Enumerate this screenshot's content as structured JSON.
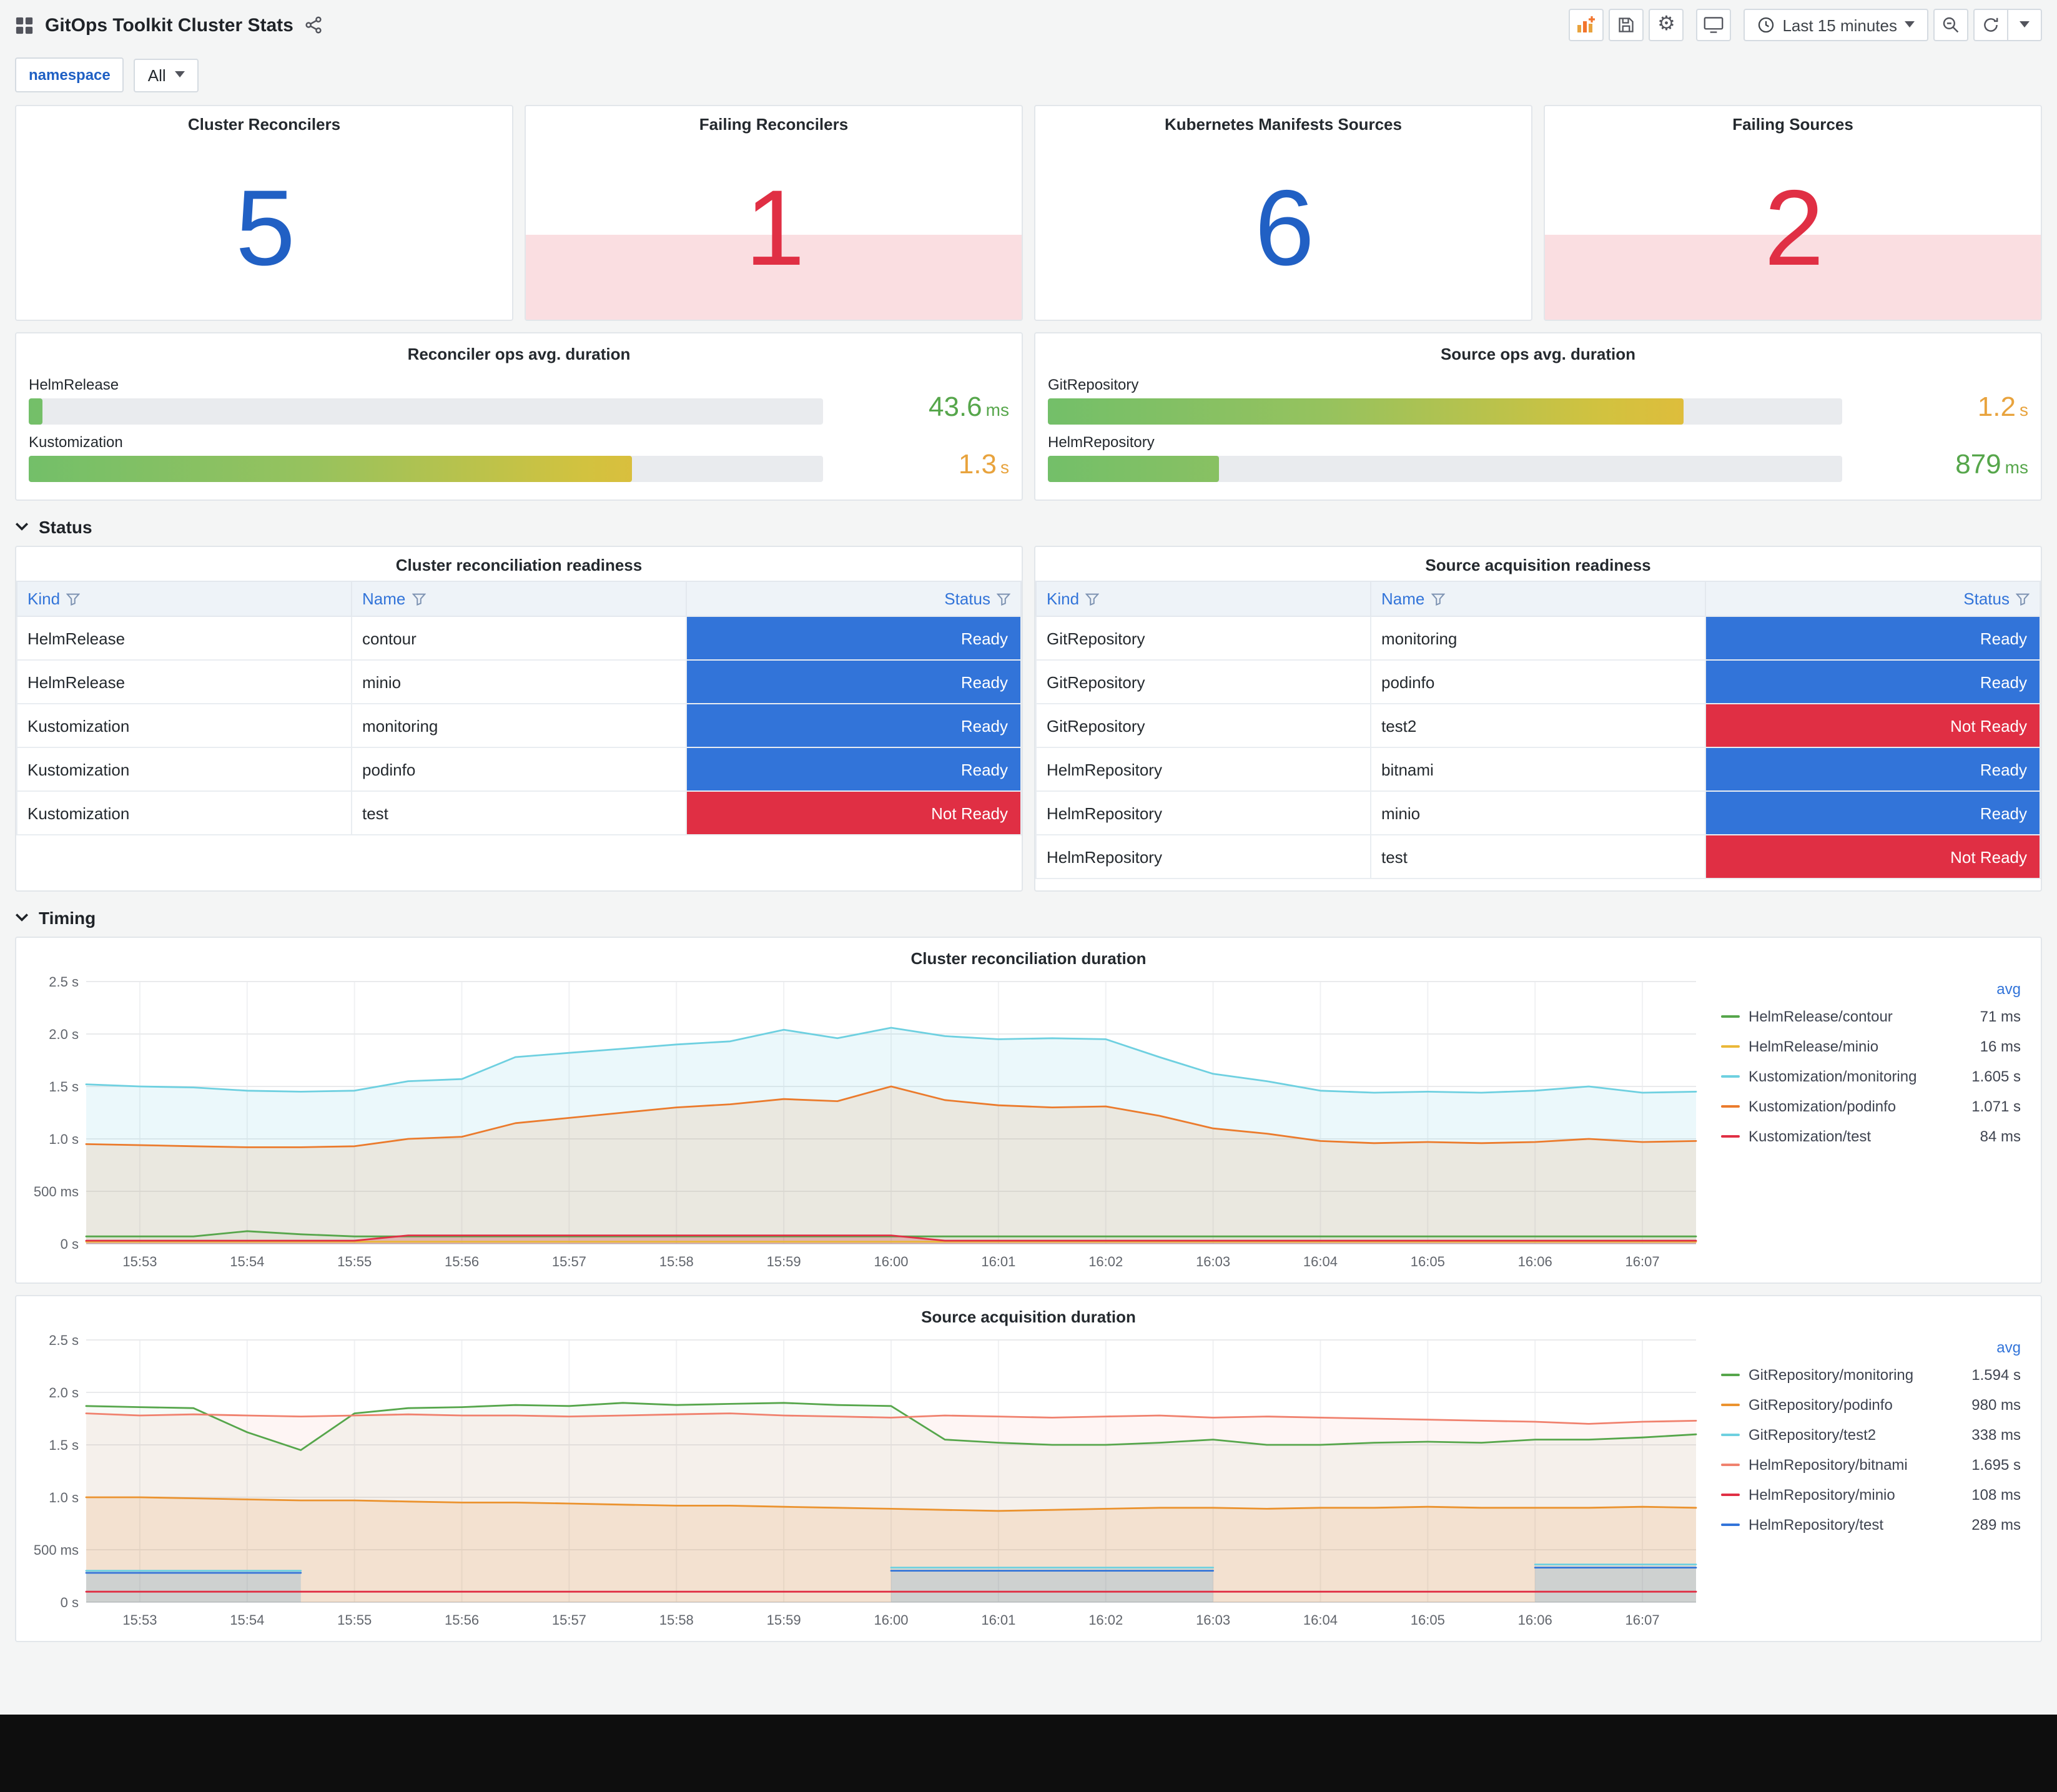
{
  "header": {
    "title": "GitOps Toolkit Cluster Stats",
    "time_range": "Last 15 minutes"
  },
  "icons": {
    "grid-icon": "four-squares",
    "share-icon": "share-nodes",
    "add-panel-icon": "bar-chart-plus",
    "save-icon": "floppy-disk",
    "gear-icon": "⚙",
    "monitor-icon": "tv-display",
    "clock-icon": "clock-face",
    "caret-down-icon": "▾",
    "zoom-out-icon": "magnifier-minus",
    "refresh-icon": "circular-arrows",
    "chevron-down-icon": "⌄",
    "filter-icon": "funnel"
  },
  "variables": {
    "label": "namespace",
    "value": "All"
  },
  "stats": [
    {
      "title": "Cluster Reconcilers",
      "value": "5",
      "color": "#2160c4",
      "alert": false
    },
    {
      "title": "Failing Reconcilers",
      "value": "1",
      "color": "#e02f44",
      "alert": true
    },
    {
      "title": "Kubernetes Manifests Sources",
      "value": "6",
      "color": "#2160c4",
      "alert": false
    },
    {
      "title": "Failing Sources",
      "value": "2",
      "color": "#e02f44",
      "alert": true
    }
  ],
  "gauges": [
    {
      "title": "Reconciler ops avg. duration",
      "rows": [
        {
          "label": "HelmRelease",
          "value": "43.6",
          "unit": "ms",
          "pct": 1.8,
          "value_color": "#56a64b"
        },
        {
          "label": "Kustomization",
          "value": "1.3",
          "unit": "s",
          "pct": 76,
          "value_color": "#e8a33d"
        }
      ]
    },
    {
      "title": "Source ops avg. duration",
      "rows": [
        {
          "label": "GitRepository",
          "value": "1.2",
          "unit": "s",
          "pct": 80,
          "value_color": "#e8a33d"
        },
        {
          "label": "HelmRepository",
          "value": "879",
          "unit": "ms",
          "pct": 21.5,
          "value_color": "#56a64b"
        }
      ]
    }
  ],
  "status": {
    "section_label": "Status",
    "status_colors": {
      "Ready": "#3274d9",
      "Not Ready": "#e02f44"
    },
    "tables": [
      {
        "title": "Cluster reconciliation readiness",
        "columns": [
          "Kind",
          "Name",
          "Status"
        ],
        "rows": [
          [
            "HelmRelease",
            "contour",
            "Ready"
          ],
          [
            "HelmRelease",
            "minio",
            "Ready"
          ],
          [
            "Kustomization",
            "monitoring",
            "Ready"
          ],
          [
            "Kustomization",
            "podinfo",
            "Ready"
          ],
          [
            "Kustomization",
            "test",
            "Not Ready"
          ]
        ]
      },
      {
        "title": "Source acquisition readiness",
        "columns": [
          "Kind",
          "Name",
          "Status"
        ],
        "rows": [
          [
            "GitRepository",
            "monitoring",
            "Ready"
          ],
          [
            "GitRepository",
            "podinfo",
            "Ready"
          ],
          [
            "GitRepository",
            "test2",
            "Not Ready"
          ],
          [
            "HelmRepository",
            "bitnami",
            "Ready"
          ],
          [
            "HelmRepository",
            "minio",
            "Ready"
          ],
          [
            "HelmRepository",
            "test",
            "Not Ready"
          ]
        ]
      }
    ]
  },
  "timing": {
    "section_label": "Timing"
  },
  "chart_data": [
    {
      "type": "area",
      "title": "Cluster reconciliation duration",
      "ylim": [
        0,
        2.5
      ],
      "yticks": [
        {
          "v": 0,
          "label": "0 s"
        },
        {
          "v": 0.5,
          "label": "500 ms"
        },
        {
          "v": 1,
          "label": "1.0 s"
        },
        {
          "v": 1.5,
          "label": "1.5 s"
        },
        {
          "v": 2,
          "label": "2.0 s"
        },
        {
          "v": 2.5,
          "label": "2.5 s"
        }
      ],
      "xticks": [
        "15:53",
        "15:54",
        "15:55",
        "15:56",
        "15:57",
        "15:58",
        "15:59",
        "16:00",
        "16:01",
        "16:02",
        "16:03",
        "16:04",
        "16:05",
        "16:06",
        "16:07"
      ],
      "legend_header": "avg",
      "series": [
        {
          "name": "HelmRelease/contour",
          "avg": "71 ms",
          "color": "#56a64b",
          "fill": 0.06,
          "values": [
            0.07,
            0.07,
            0.07,
            0.12,
            0.09,
            0.07,
            0.07,
            0.07,
            0.07,
            0.07,
            0.07,
            0.07,
            0.07,
            0.07,
            0.07,
            0.07,
            0.07,
            0.07,
            0.07,
            0.07,
            0.07,
            0.07,
            0.07,
            0.07,
            0.07,
            0.07,
            0.07,
            0.07,
            0.07,
            0.07,
            0.07
          ]
        },
        {
          "name": "HelmRelease/minio",
          "avg": "16 ms",
          "color": "#eab839",
          "fill": 0,
          "values": [
            0.02,
            0.02,
            0.02,
            0.02,
            0.02,
            0.02,
            0.02,
            0.02,
            0.02,
            0.02,
            0.02,
            0.02,
            0.02,
            0.02,
            0.02,
            0.02,
            0.02,
            0.02,
            0.02,
            0.02,
            0.02,
            0.02,
            0.02,
            0.02,
            0.02,
            0.02,
            0.02,
            0.02,
            0.02,
            0.02,
            0.02
          ]
        },
        {
          "name": "Kustomization/monitoring",
          "avg": "1.605 s",
          "color": "#6ed0e0",
          "fill": 0.14,
          "values": [
            1.52,
            1.5,
            1.49,
            1.46,
            1.45,
            1.46,
            1.55,
            1.57,
            1.78,
            1.82,
            1.86,
            1.9,
            1.93,
            2.04,
            1.96,
            2.06,
            1.98,
            1.95,
            1.96,
            1.95,
            1.78,
            1.62,
            1.55,
            1.46,
            1.44,
            1.45,
            1.44,
            1.46,
            1.5,
            1.44,
            1.45
          ]
        },
        {
          "name": "Kustomization/podinfo",
          "avg": "1.071 s",
          "color": "#eb7b2d",
          "fill": 0.13,
          "values": [
            0.95,
            0.94,
            0.93,
            0.92,
            0.92,
            0.93,
            1.0,
            1.02,
            1.15,
            1.2,
            1.25,
            1.3,
            1.33,
            1.38,
            1.36,
            1.5,
            1.37,
            1.32,
            1.3,
            1.31,
            1.22,
            1.1,
            1.05,
            0.98,
            0.96,
            0.97,
            0.96,
            0.97,
            1.0,
            0.97,
            0.98
          ]
        },
        {
          "name": "Kustomization/test",
          "avg": "84 ms",
          "color": "#e02f44",
          "fill": 0.25,
          "values": [
            0.03,
            0.03,
            0.03,
            0.03,
            0.03,
            0.03,
            0.08,
            0.08,
            0.08,
            0.08,
            0.08,
            0.08,
            0.08,
            0.08,
            0.08,
            0.08,
            0.03,
            0.03,
            0.03,
            0.03,
            0.03,
            0.03,
            0.03,
            0.03,
            0.03,
            0.03,
            0.03,
            0.03,
            0.03,
            0.03,
            0.03
          ]
        }
      ]
    },
    {
      "type": "area",
      "title": "Source acquisition duration",
      "ylim": [
        0,
        2.5
      ],
      "yticks": [
        {
          "v": 0,
          "label": "0 s"
        },
        {
          "v": 0.5,
          "label": "500 ms"
        },
        {
          "v": 1,
          "label": "1.0 s"
        },
        {
          "v": 1.5,
          "label": "1.5 s"
        },
        {
          "v": 2,
          "label": "2.0 s"
        },
        {
          "v": 2.5,
          "label": "2.5 s"
        }
      ],
      "xticks": [
        "15:53",
        "15:54",
        "15:55",
        "15:56",
        "15:57",
        "15:58",
        "15:59",
        "16:00",
        "16:01",
        "16:02",
        "16:03",
        "16:04",
        "16:05",
        "16:06",
        "16:07"
      ],
      "legend_header": "avg",
      "series": [
        {
          "name": "GitRepository/monitoring",
          "avg": "1.594 s",
          "color": "#56a64b",
          "fill": 0.05,
          "values": [
            1.87,
            1.86,
            1.85,
            1.62,
            1.45,
            1.8,
            1.85,
            1.86,
            1.88,
            1.87,
            1.9,
            1.88,
            1.89,
            1.9,
            1.88,
            1.87,
            1.55,
            1.52,
            1.5,
            1.5,
            1.52,
            1.55,
            1.5,
            1.5,
            1.52,
            1.53,
            1.52,
            1.55,
            1.55,
            1.57,
            1.6
          ]
        },
        {
          "name": "GitRepository/podinfo",
          "avg": "980 ms",
          "color": "#eb932f",
          "fill": 0.15,
          "values": [
            1.0,
            1.0,
            0.99,
            0.98,
            0.97,
            0.97,
            0.96,
            0.95,
            0.95,
            0.94,
            0.93,
            0.92,
            0.92,
            0.91,
            0.9,
            0.89,
            0.88,
            0.87,
            0.88,
            0.89,
            0.9,
            0.9,
            0.89,
            0.9,
            0.9,
            0.91,
            0.9,
            0.9,
            0.9,
            0.91,
            0.9
          ]
        },
        {
          "name": "GitRepository/test2",
          "avg": "338 ms",
          "color": "#6ed0e0",
          "fill": 0.12,
          "values": [
            0.3,
            0.3,
            0.3,
            0.3,
            0.3,
            null,
            null,
            null,
            null,
            null,
            null,
            null,
            null,
            null,
            null,
            0.33,
            0.33,
            0.33,
            0.33,
            0.33,
            0.33,
            0.33,
            null,
            null,
            null,
            null,
            null,
            0.36,
            0.36,
            0.36,
            0.36
          ]
        },
        {
          "name": "HelmRepository/bitnami",
          "avg": "1.695 s",
          "color": "#f0816e",
          "fill": 0.08,
          "values": [
            1.8,
            1.78,
            1.79,
            1.78,
            1.77,
            1.78,
            1.79,
            1.78,
            1.78,
            1.77,
            1.78,
            1.79,
            1.8,
            1.78,
            1.77,
            1.76,
            1.78,
            1.77,
            1.76,
            1.77,
            1.78,
            1.76,
            1.77,
            1.76,
            1.75,
            1.74,
            1.73,
            1.72,
            1.7,
            1.72,
            1.73
          ]
        },
        {
          "name": "HelmRepository/minio",
          "avg": "108 ms",
          "color": "#e02f44",
          "fill": 0,
          "values": [
            0.1,
            0.1,
            0.1,
            0.1,
            0.1,
            0.1,
            0.1,
            0.1,
            0.1,
            0.1,
            0.1,
            0.1,
            0.1,
            0.1,
            0.1,
            0.1,
            0.1,
            0.1,
            0.1,
            0.1,
            0.1,
            0.1,
            0.1,
            0.1,
            0.1,
            0.1,
            0.1,
            0.1,
            0.1,
            0.1,
            0.1
          ]
        },
        {
          "name": "HelmRepository/test",
          "avg": "289 ms",
          "color": "#3274d9",
          "fill": 0.12,
          "values": [
            0.28,
            0.28,
            0.28,
            0.28,
            0.28,
            null,
            null,
            null,
            null,
            null,
            null,
            null,
            null,
            null,
            null,
            0.3,
            0.3,
            0.3,
            0.3,
            0.3,
            0.3,
            0.3,
            null,
            null,
            null,
            null,
            null,
            0.33,
            0.33,
            0.33,
            0.33
          ]
        }
      ]
    }
  ]
}
